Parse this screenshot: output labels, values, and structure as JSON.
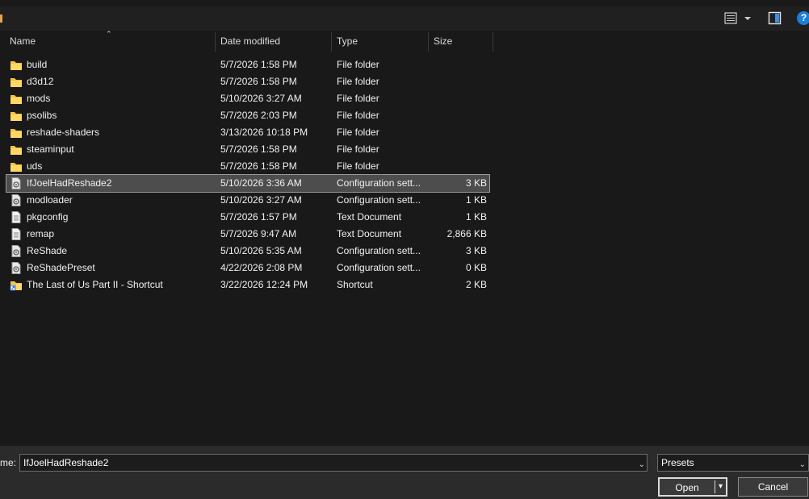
{
  "toolbar": {
    "help_label": "?"
  },
  "columns": {
    "name": "Name",
    "date": "Date modified",
    "type": "Type",
    "size": "Size"
  },
  "files": [
    {
      "name": "build",
      "date": "5/7/2026 1:58 PM",
      "type": "File folder",
      "size": "",
      "icon": "folder-icon"
    },
    {
      "name": "d3d12",
      "date": "5/7/2026 1:58 PM",
      "type": "File folder",
      "size": "",
      "icon": "folder-icon"
    },
    {
      "name": "mods",
      "date": "5/10/2026 3:27 AM",
      "type": "File folder",
      "size": "",
      "icon": "folder-icon"
    },
    {
      "name": "psolibs",
      "date": "5/7/2026 2:03 PM",
      "type": "File folder",
      "size": "",
      "icon": "folder-icon"
    },
    {
      "name": "reshade-shaders",
      "date": "3/13/2026 10:18 PM",
      "type": "File folder",
      "size": "",
      "icon": "folder-icon"
    },
    {
      "name": "steaminput",
      "date": "5/7/2026 1:58 PM",
      "type": "File folder",
      "size": "",
      "icon": "folder-icon"
    },
    {
      "name": "uds",
      "date": "5/7/2026 1:58 PM",
      "type": "File folder",
      "size": "",
      "icon": "folder-icon"
    },
    {
      "name": "IfJoelHadReshade2",
      "date": "5/10/2026 3:36 AM",
      "type": "Configuration sett...",
      "size": "3 KB",
      "icon": "config-file-icon",
      "selected": true
    },
    {
      "name": "modloader",
      "date": "5/10/2026 3:27 AM",
      "type": "Configuration sett...",
      "size": "1 KB",
      "icon": "config-file-icon"
    },
    {
      "name": "pkgconfig",
      "date": "5/7/2026 1:57 PM",
      "type": "Text Document",
      "size": "1 KB",
      "icon": "text-file-icon"
    },
    {
      "name": "remap",
      "date": "5/7/2026 9:47 AM",
      "type": "Text Document",
      "size": "2,866 KB",
      "icon": "text-file-icon"
    },
    {
      "name": "ReShade",
      "date": "5/10/2026 5:35 AM",
      "type": "Configuration sett...",
      "size": "3 KB",
      "icon": "config-file-icon"
    },
    {
      "name": "ReShadePreset",
      "date": "4/22/2026 2:08 PM",
      "type": "Configuration sett...",
      "size": "0 KB",
      "icon": "config-file-icon"
    },
    {
      "name": "The Last of Us Part II - Shortcut",
      "date": "3/22/2026 12:24 PM",
      "type": "Shortcut",
      "size": "2 KB",
      "icon": "shortcut-icon"
    }
  ],
  "bottom": {
    "filename_label": "me:",
    "filename_value": "IfJoelHadReshade2",
    "filter_value": "Presets",
    "open_label": "Open",
    "cancel_label": "Cancel"
  },
  "colors": {
    "folder": "#f6c244",
    "accent": "#1a7fd9",
    "selected_row": "#4d4d4d"
  }
}
